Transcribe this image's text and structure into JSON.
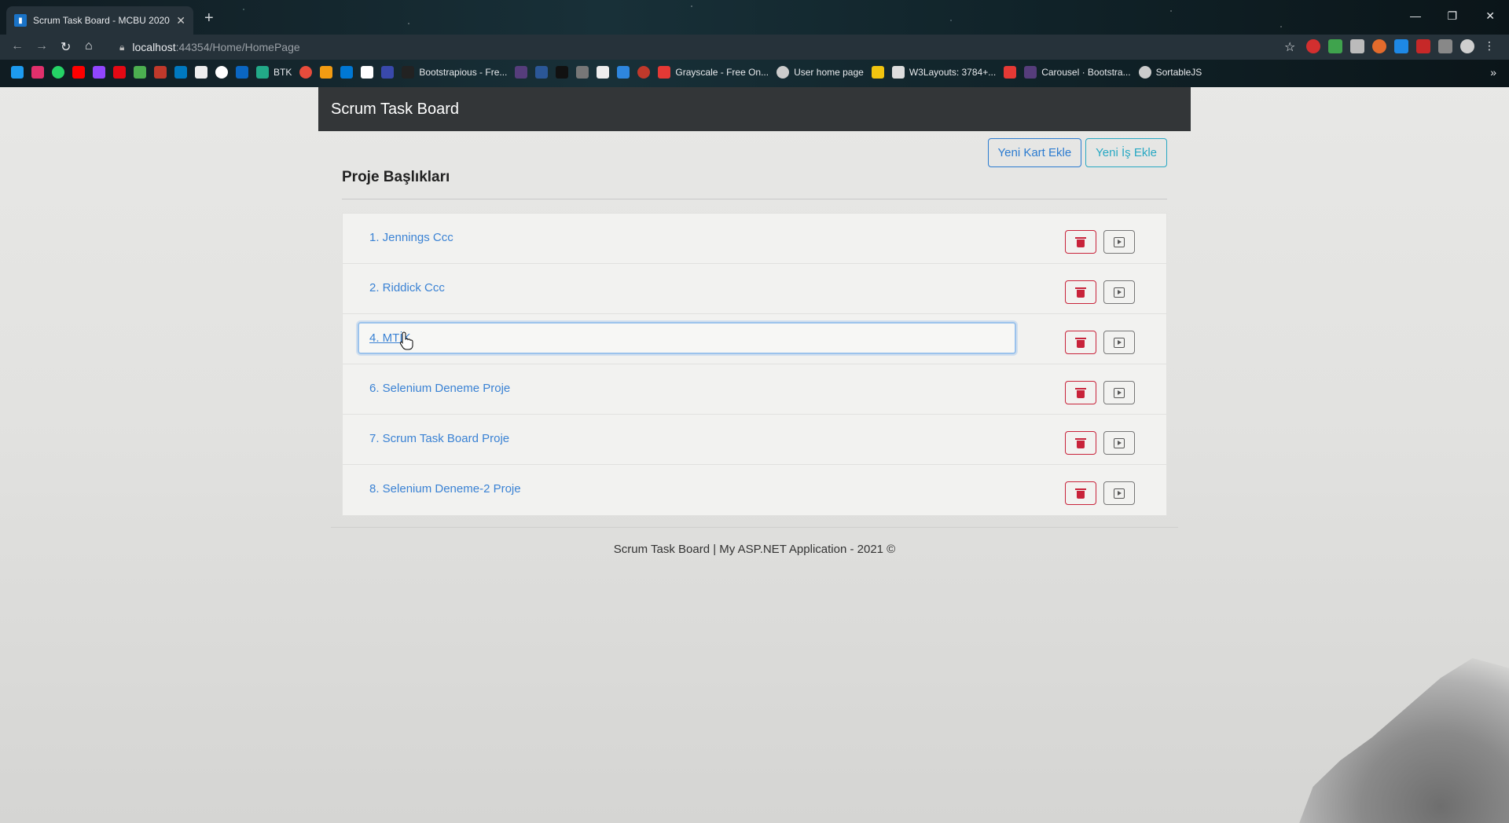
{
  "browser": {
    "tab_title": "Scrum Task Board - MCBU 2020",
    "url_host": "localhost",
    "url_path": ":44354/Home/HomePage",
    "bookmarks": [
      "BTK",
      "Bootstrapious - Fre...",
      "Grayscale - Free On...",
      "User home page",
      "W3Layouts: 3784+...",
      "Carousel · Bootstra...",
      "SortableJS"
    ]
  },
  "navbar": {
    "brand": "Scrum Task Board"
  },
  "actions": {
    "new_card": "Yeni Kart Ekle",
    "new_task": "Yeni İş Ekle"
  },
  "section": {
    "title": "Proje Başlıkları"
  },
  "projects": [
    {
      "label": "1. Jennings Ccc"
    },
    {
      "label": "2. Riddick Ccc"
    },
    {
      "label": "4. MTİK"
    },
    {
      "label": "6. Selenium Deneme Proje"
    },
    {
      "label": "7. Scrum Task Board Proje"
    },
    {
      "label": "8. Selenium Deneme-2 Proje"
    }
  ],
  "footer": {
    "text": "Scrum Task Board | My ASP.NET Application - 2021 ©"
  },
  "colors": {
    "primary": "#2b7bd0",
    "info": "#27a8c3",
    "danger": "#c8233a",
    "navbar": "#333638"
  }
}
